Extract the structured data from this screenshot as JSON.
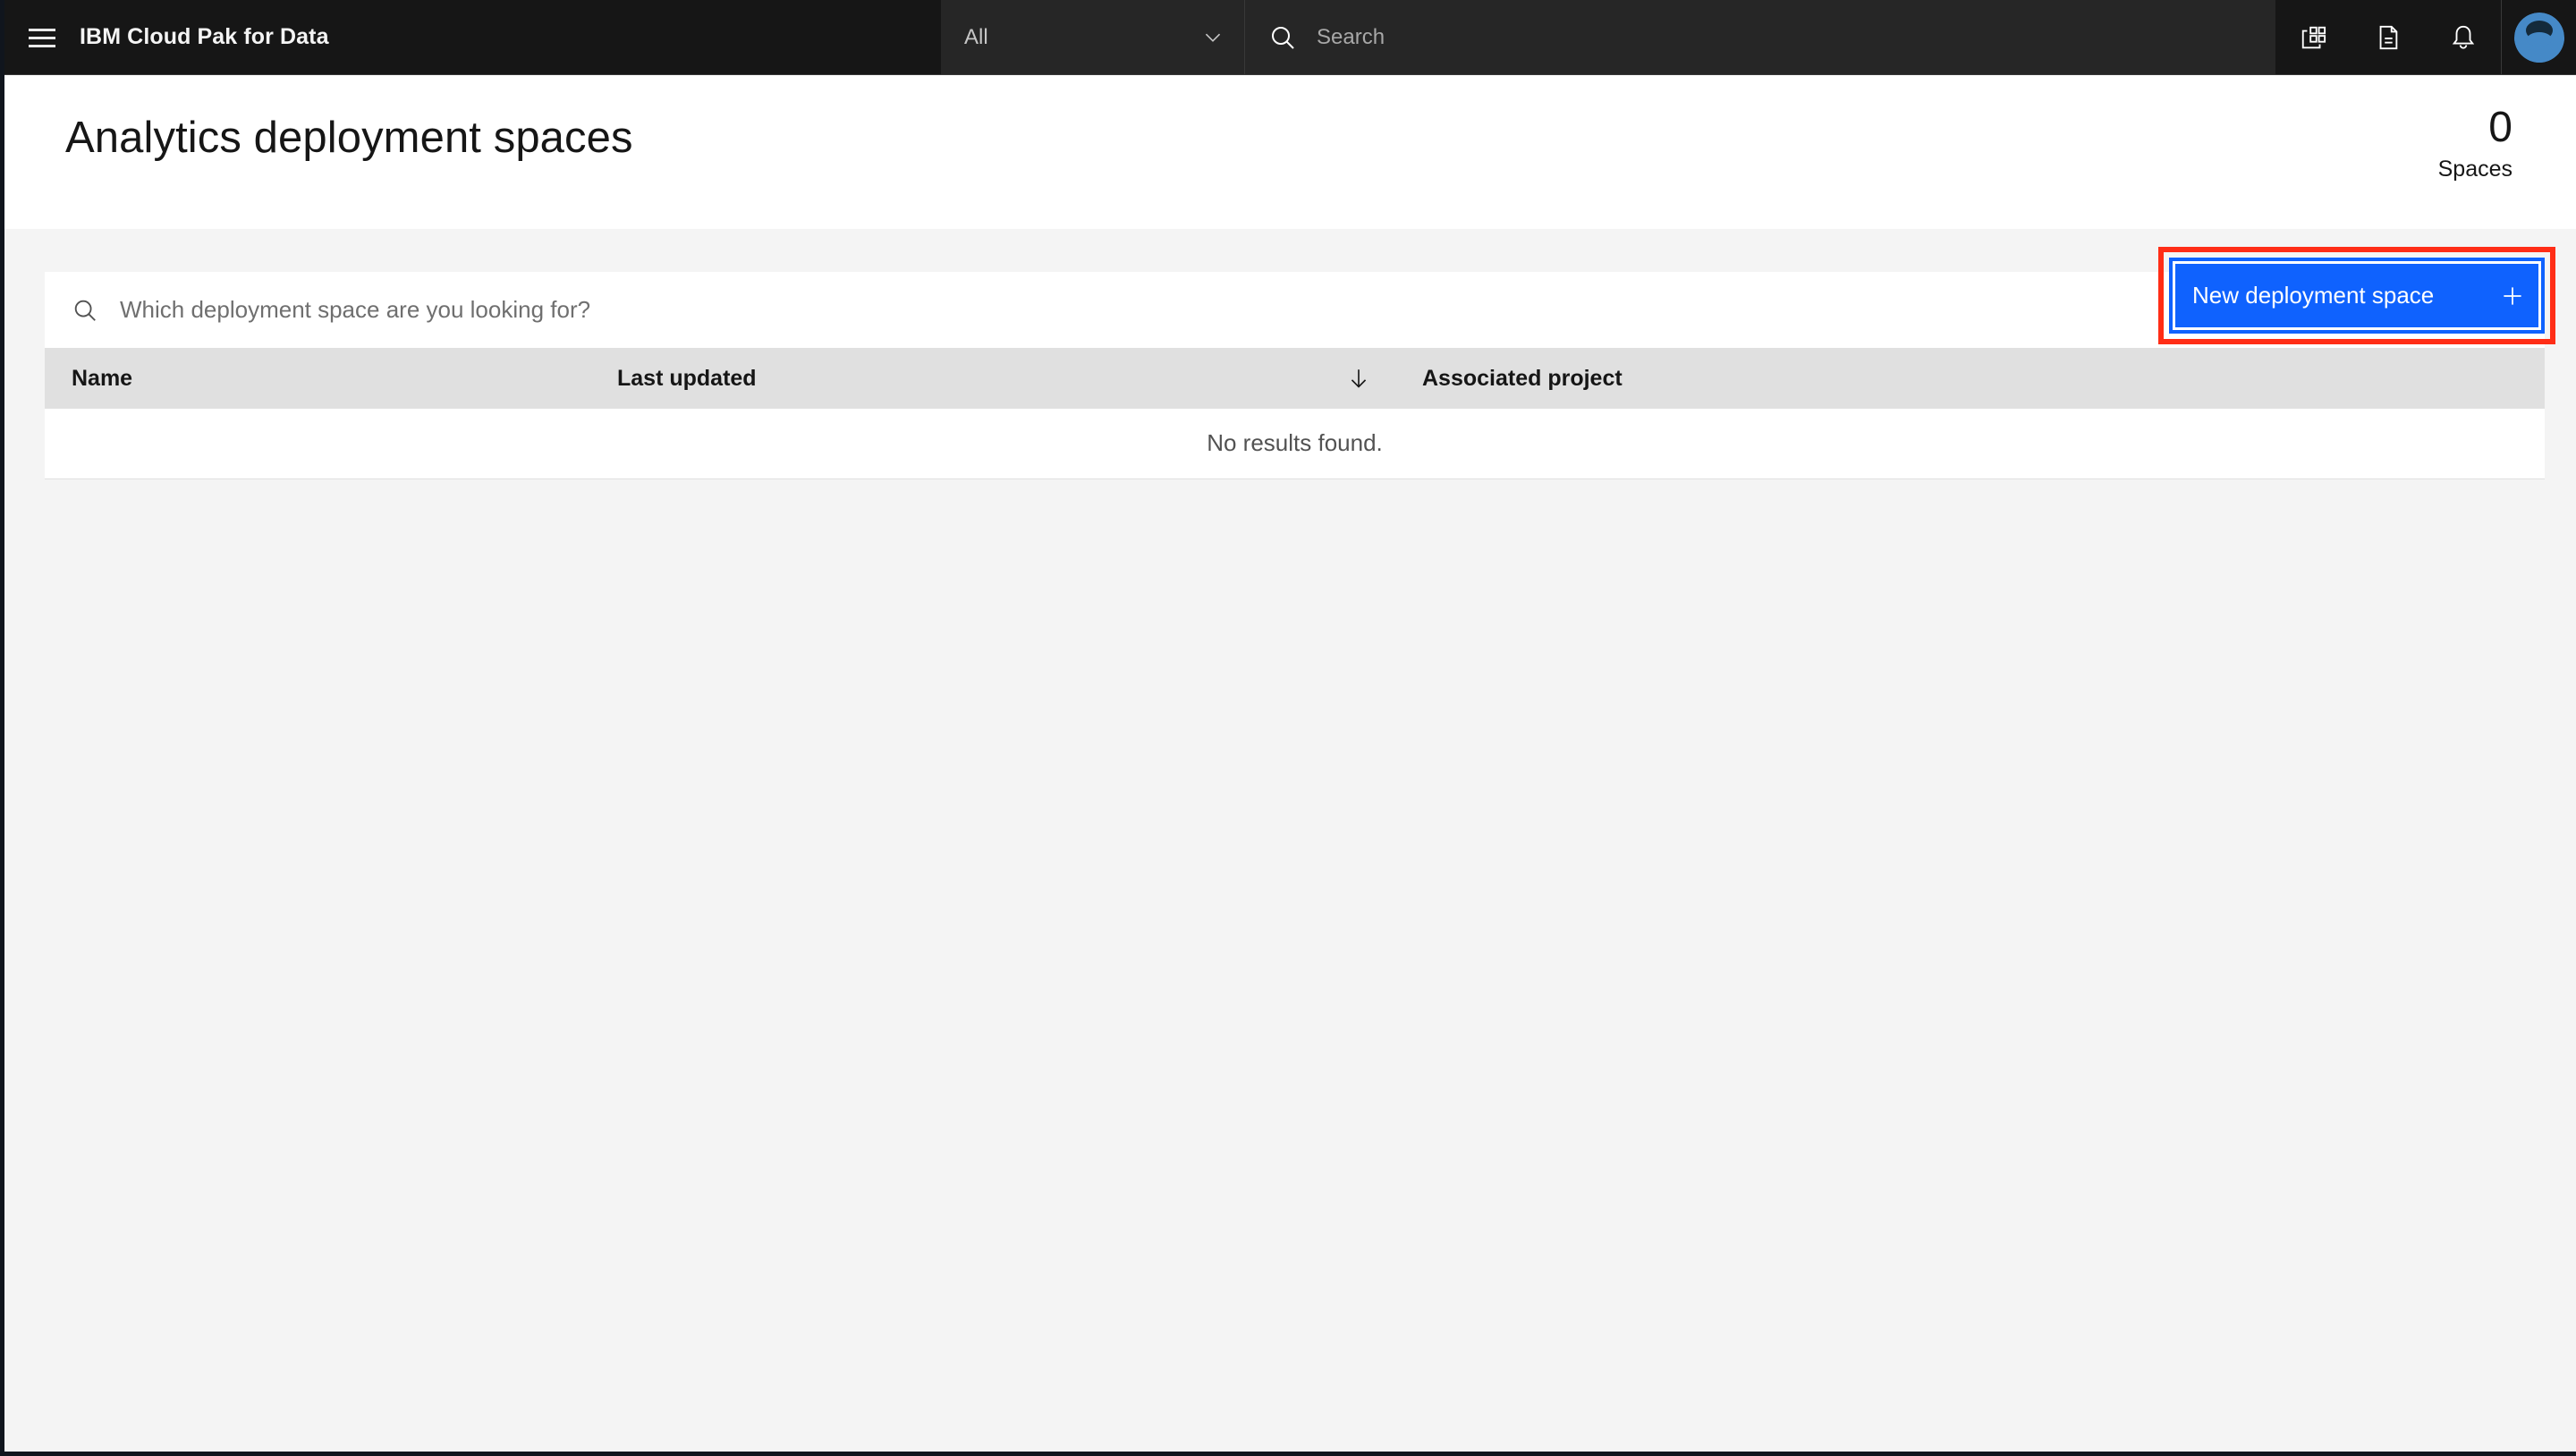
{
  "shell": {
    "menu_icon": "hamburger-menu-icon",
    "brand": "IBM Cloud Pak for Data",
    "scope": {
      "selected": "All",
      "chevron_icon": "chevron-down-icon"
    },
    "search": {
      "icon": "search-icon",
      "placeholder": "Search",
      "value": ""
    },
    "actions": [
      {
        "name": "app-switcher-icon",
        "label": ""
      },
      {
        "name": "document-icon",
        "label": ""
      },
      {
        "name": "notification-bell-icon",
        "label": ""
      }
    ],
    "avatar": {
      "name": "user-avatar",
      "color": "#4589c7"
    }
  },
  "page": {
    "title": "Analytics deployment spaces",
    "count": "0",
    "count_label": "Spaces"
  },
  "toolbar": {
    "search_icon": "search-icon",
    "search_placeholder": "Which deployment space are you looking for?",
    "search_value": "",
    "new_space_label": "New deployment space",
    "new_space_icon": "plus-icon",
    "highlight_color": "#ff2d16",
    "button_color": "#0f62fe"
  },
  "table": {
    "columns": [
      {
        "key": "name",
        "label": "Name",
        "sorted": false
      },
      {
        "key": "last_updated",
        "label": "Last updated",
        "sorted": true,
        "sort_direction": "descending",
        "sort_icon": "arrow-down-icon"
      },
      {
        "key": "associated_project",
        "label": "Associated project",
        "sorted": false
      }
    ],
    "rows": [],
    "empty_message": "No results found."
  }
}
